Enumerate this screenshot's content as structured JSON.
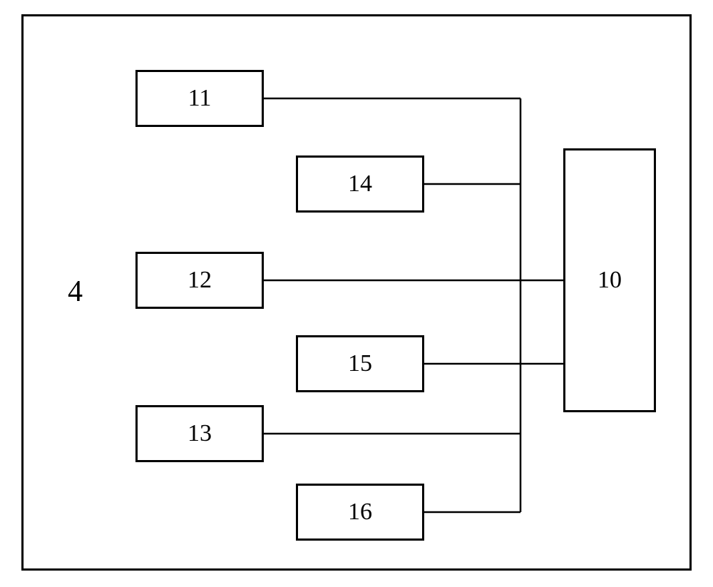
{
  "diagram_label": "4",
  "blocks": {
    "b11": "11",
    "b12": "12",
    "b13": "13",
    "b14": "14",
    "b15": "15",
    "b16": "16",
    "b10": "10"
  }
}
